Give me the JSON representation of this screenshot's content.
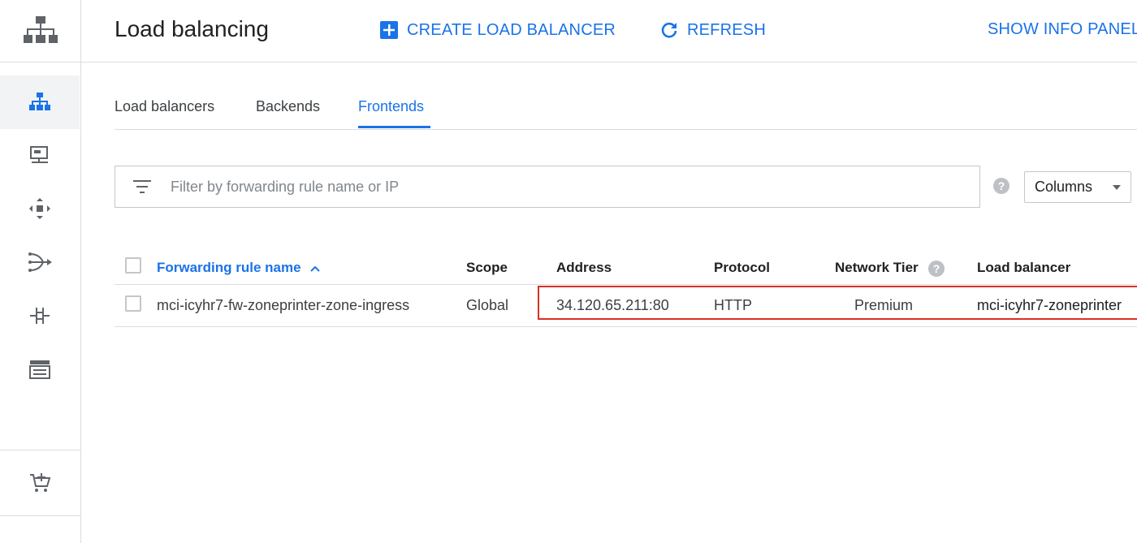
{
  "header": {
    "title": "Load balancing",
    "create_label": "CREATE LOAD BALANCER",
    "refresh_label": "REFRESH",
    "info_panel_label": "SHOW INFO PANEL"
  },
  "tabs": [
    {
      "label": "Load balancers",
      "active": false
    },
    {
      "label": "Backends",
      "active": false
    },
    {
      "label": "Frontends",
      "active": true
    }
  ],
  "filter": {
    "placeholder": "Filter by forwarding rule name or IP",
    "columns_label": "Columns"
  },
  "table": {
    "columns": [
      "Forwarding rule name",
      "Scope",
      "Address",
      "Protocol",
      "Network Tier",
      "Load balancer"
    ],
    "sort_indicator": "^",
    "rows": [
      {
        "name": "mci-icyhr7-fw-zoneprinter-zone-ingress",
        "scope": "Global",
        "address": "34.120.65.211:80",
        "protocol": "HTTP",
        "tier": "Premium",
        "load_balancer": "mci-icyhr7-zoneprinter"
      }
    ]
  },
  "sidebar": {
    "items": [
      {
        "icon": "network-hierarchy-icon",
        "active": true
      },
      {
        "icon": "server-icon",
        "active": false
      },
      {
        "icon": "expand-arrows-icon",
        "active": false
      },
      {
        "icon": "routing-icon",
        "active": false
      },
      {
        "icon": "interconnect-icon",
        "active": false
      },
      {
        "icon": "storage-icon",
        "active": false
      },
      {
        "icon": "marketplace-cart-icon",
        "active": false
      }
    ]
  },
  "colors": {
    "accent": "#1a73e8",
    "highlight": "#d93025",
    "border": "#dadce0"
  }
}
